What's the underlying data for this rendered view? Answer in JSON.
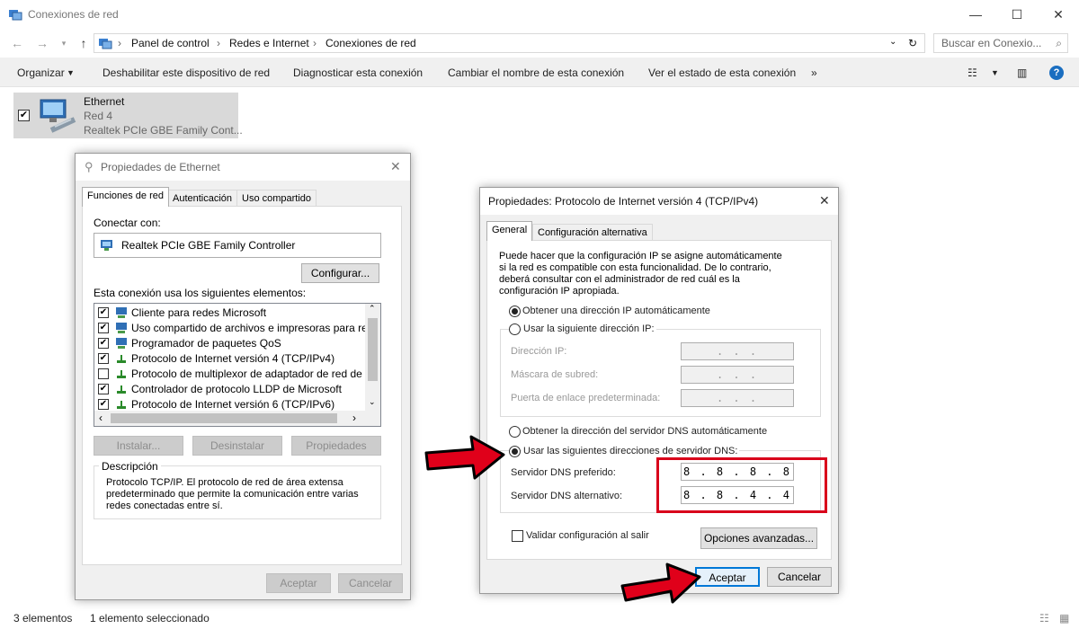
{
  "window": {
    "title": "Conexiones de red",
    "breadcrumb": [
      "Panel de control",
      "Redes e Internet",
      "Conexiones de red"
    ],
    "search_placeholder": "Buscar en Conexio...",
    "commands": [
      "Organizar",
      "Deshabilitar este dispositivo de red",
      "Diagnosticar esta conexión",
      "Cambiar el nombre de esta conexión",
      "Ver el estado de esta conexión",
      "»"
    ]
  },
  "connection": {
    "name": "Ethernet",
    "network": "Red 4",
    "adapter": "Realtek PCIe GBE Family Cont..."
  },
  "status": {
    "count": "3 elementos",
    "selected": "1 elemento seleccionado"
  },
  "eth_dialog": {
    "title": "Propiedades de Ethernet",
    "tabs": [
      "Funciones de red",
      "Autenticación",
      "Uso compartido"
    ],
    "connect_with_label": "Conectar con:",
    "adapter_name": "Realtek PCIe GBE Family Controller",
    "configure_button": "Configurar...",
    "items_label": "Esta conexión usa los siguientes elementos:",
    "items": [
      {
        "label": "Cliente para redes Microsoft",
        "checked": "✔"
      },
      {
        "label": "Uso compartido de archivos e impresoras para redes M",
        "checked": "✔"
      },
      {
        "label": "Programador de paquetes QoS",
        "checked": "✔"
      },
      {
        "label": "Protocolo de Internet versión 4 (TCP/IPv4)",
        "checked": "✔"
      },
      {
        "label": "Protocolo de multiplexor de adaptador de red de Micros",
        "checked": ""
      },
      {
        "label": "Controlador de protocolo LLDP de Microsoft",
        "checked": "✔"
      },
      {
        "label": "Protocolo de Internet versión 6 (TCP/IPv6)",
        "checked": "✔"
      }
    ],
    "install_button": "Instalar...",
    "uninstall_button": "Desinstalar",
    "properties_button": "Propiedades",
    "description_title": "Descripción",
    "description_text": "Protocolo TCP/IP. El protocolo de red de área extensa predeterminado que permite la comunicación entre varias redes conectadas entre sí.",
    "ok_button": "Aceptar",
    "cancel_button": "Cancelar"
  },
  "ipv4_dialog": {
    "title": "Propiedades: Protocolo de Internet versión 4 (TCP/IPv4)",
    "tabs": [
      "General",
      "Configuración alternativa"
    ],
    "intro": "Puede hacer que la configuración IP se asigne automáticamente si la red es compatible con esta funcionalidad. De lo contrario, deberá consultar con el administrador de red cuál es la configuración IP apropiada.",
    "auto_ip": "Obtener una dirección IP automáticamente",
    "manual_ip": "Usar la siguiente dirección IP:",
    "ip_label": "Dirección IP:",
    "mask_label": "Máscara de subred:",
    "gateway_label": "Puerta de enlace predeterminada:",
    "empty_ip": ".    .    .",
    "auto_dns": "Obtener la dirección del servidor DNS automáticamente",
    "manual_dns": "Usar las siguientes direcciones de servidor DNS:",
    "preferred_dns_label": "Servidor DNS preferido:",
    "alternate_dns_label": "Servidor DNS alternativo:",
    "preferred_dns": "8 . 8 . 8 . 8",
    "alternate_dns": "8 . 8 . 4 . 4",
    "validate_label": "Validar configuración al salir",
    "advanced_button": "Opciones avanzadas...",
    "ok_button": "Aceptar",
    "cancel_button": "Cancelar"
  },
  "colors": {
    "highlight_box": "#d9001b",
    "arrow": "#e0001a"
  }
}
